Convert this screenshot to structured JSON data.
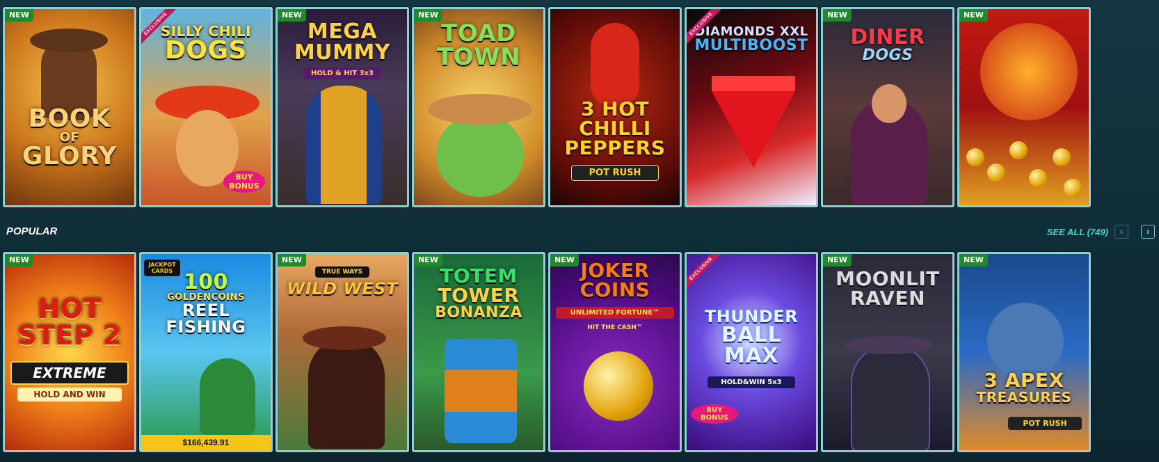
{
  "badges": {
    "new": "NEW",
    "exclusive": "EXCLUSIVE"
  },
  "section": {
    "title": "POPULAR",
    "see_all": "SEE ALL (749)",
    "prev_icon": "chevron-left-icon",
    "next_icon": "chevron-right-icon"
  },
  "row1": [
    {
      "id": "book-of-glory",
      "lines": [
        "BOOK",
        "OF",
        "GLORY"
      ],
      "badge": "new"
    },
    {
      "id": "silly-chili-dogs",
      "lines": [
        "SILLY CHILI",
        "DOGS"
      ],
      "sub": "BUY BONUS",
      "badge": "exclusive"
    },
    {
      "id": "mega-mummy",
      "lines": [
        "MEGA",
        "MUMMY"
      ],
      "sub": "HOLD & HIT 3x3",
      "badge": "new"
    },
    {
      "id": "toad-town",
      "lines": [
        "TOAD",
        "TOWN"
      ],
      "badge": "new"
    },
    {
      "id": "3-hot-chilli-peppers",
      "lines": [
        "3 HOT",
        "CHILLI",
        "PEPPERS"
      ],
      "sub": "POT RUSH",
      "badge": "none"
    },
    {
      "id": "diamonds-xxl-multiboost",
      "lines": [
        "DIAMONDS XXL",
        "MULTIBOOST"
      ],
      "badge": "exclusive"
    },
    {
      "id": "diner-dogs",
      "lines": [
        "DINER",
        "DOGS"
      ],
      "badge": "new"
    },
    {
      "id": "dragon-gold",
      "lines": [],
      "badge": "new"
    }
  ],
  "row2": [
    {
      "id": "hot-step-2-extreme",
      "lines": [
        "HOT",
        "STEP 2"
      ],
      "sub": "EXTREME",
      "sub2": "HOLD AND WIN",
      "badge": "new"
    },
    {
      "id": "100-golden-coins-reel-fishing",
      "lines": [
        "100",
        "GOLDENCOINS",
        "REEL",
        "FISHING"
      ],
      "sub": "JACKPOT CARDS",
      "jackpot": "$166,439.91",
      "badge": "none"
    },
    {
      "id": "true-ways-wild-west",
      "lines": [
        "WILD WEST"
      ],
      "sub": "TRUE WAYS",
      "badge": "new"
    },
    {
      "id": "totem-tower-bonanza",
      "lines": [
        "TOTEM",
        "TOWER",
        "BONANZA"
      ],
      "badge": "new"
    },
    {
      "id": "joker-coins",
      "lines": [
        "JOKER",
        "COINS"
      ],
      "sub": "UNLIMITED FORTUNE™",
      "sub2": "HIT THE CASH™",
      "badge": "new"
    },
    {
      "id": "thunder-ball-max",
      "lines": [
        "THUNDER",
        "BALL",
        "MAX"
      ],
      "sub": "HOLD&WIN 5x3",
      "sub2": "BUY BONUS",
      "badge": "exclusive"
    },
    {
      "id": "moonlit-raven",
      "lines": [
        "MOONLIT",
        "RAVEN"
      ],
      "badge": "new"
    },
    {
      "id": "3-apex-treasures",
      "lines": [
        "3 APEX",
        "TREASURES"
      ],
      "sub": "POT RUSH",
      "badge": "new"
    }
  ]
}
